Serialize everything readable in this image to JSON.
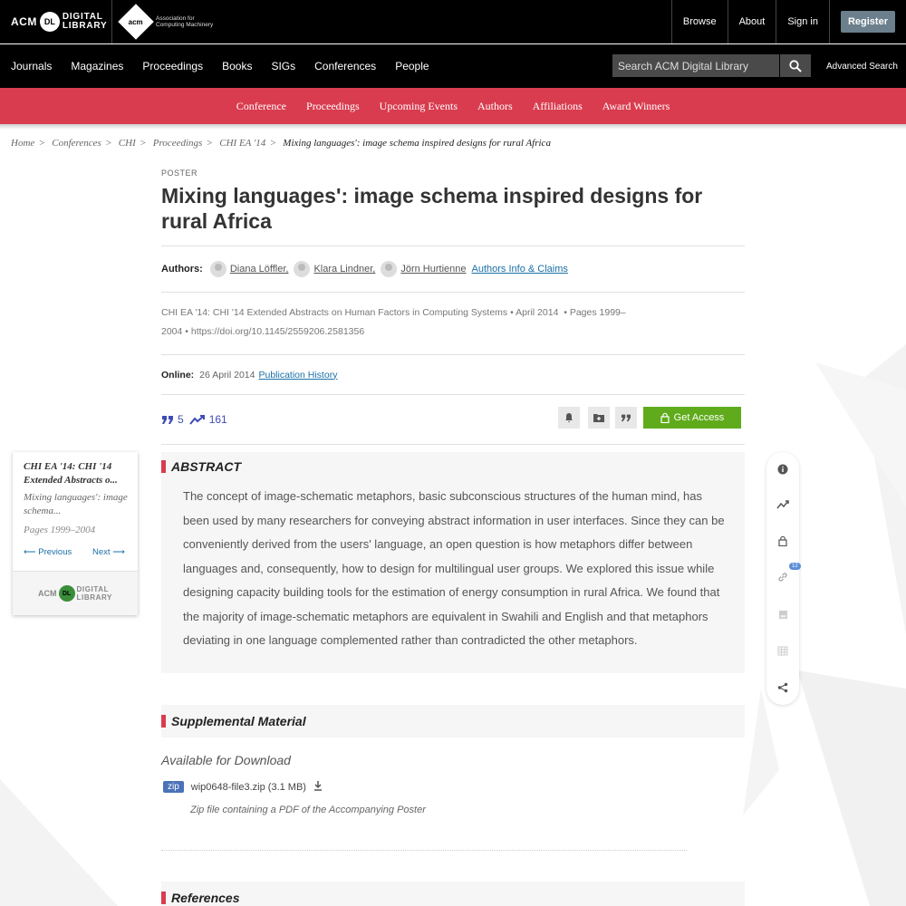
{
  "header": {
    "dl_logo": {
      "acm": "ACM",
      "badge": "DL",
      "line1": "DIGITAL",
      "line2": "LIBRARY"
    },
    "acm_logo": {
      "mark": "acm",
      "line1": "Association for",
      "line2": "Computing Machinery"
    },
    "links": [
      "Browse",
      "About",
      "Sign in"
    ],
    "register": "Register"
  },
  "nav": {
    "items": [
      "Journals",
      "Magazines",
      "Proceedings",
      "Books",
      "SIGs",
      "Conferences",
      "People"
    ],
    "search_placeholder": "Search ACM Digital Library",
    "advanced": "Advanced Search"
  },
  "subnav": [
    "Conference",
    "Proceedings",
    "Upcoming Events",
    "Authors",
    "Affiliations",
    "Award Winners"
  ],
  "breadcrumb": {
    "items": [
      "Home",
      "Conferences",
      "CHI",
      "Proceedings",
      "CHI EA '14"
    ],
    "current": "Mixing languages': image schema inspired designs for rural Africa"
  },
  "article": {
    "type": "POSTER",
    "title": "Mixing languages': image schema inspired designs for rural Africa",
    "authors_label": "Authors:",
    "authors": [
      "Diana Löffler,",
      "Klara Lindner,",
      "Jörn Hurtienne"
    ],
    "authors_info": "Authors Info & Claims",
    "venue_name": "CHI EA '14: CHI '14 Extended Abstracts on Human Factors in Computing Systems",
    "venue_date": "April 2014",
    "pages_line1": "Pages 1999–",
    "pages_line2": "2004",
    "doi": "https://doi.org/10.1145/2559206.2581356",
    "online_label": "Online:",
    "online_date": "26 April 2014",
    "pub_history": "Publication History",
    "citations": "5",
    "downloads": "161",
    "get_access": "Get Access"
  },
  "sidecard": {
    "title": "CHI EA '14: CHI '14 Extended Abstracts o...",
    "article": "Mixing languages': image schema...",
    "pages": "Pages 1999–2004",
    "previous": "Previous",
    "next": "Next",
    "logo": {
      "acm": "ACM",
      "badge": "DL",
      "line1": "DIGITAL",
      "line2": "LIBRARY"
    }
  },
  "abstract": {
    "heading": "ABSTRACT",
    "text": "The concept of image-schematic metaphors, basic subconscious structures of the human mind, has been used by many researchers for conveying abstract information in user interfaces. Since they can be conveniently derived from the users' language, an open question is how metaphors differ between languages and, consequently, how to design for multilingual user groups. We explored this issue while designing capacity building tools for the estimation of energy consumption in rural Africa. We found that the majority of image-schematic metaphors are equivalent in Swahili and English and that metaphors deviating in one language complemented rather than contradicted the other metaphors."
  },
  "toolbar": {
    "badge": "12",
    "icons": [
      "info-icon",
      "trend-icon",
      "lock-icon",
      "link-icon",
      "image-icon",
      "table-icon",
      "share-icon"
    ]
  },
  "supplemental": {
    "heading": "Supplemental Material",
    "available": "Available for Download",
    "file_type": "zip",
    "file_name": "wip0648-file3.zip (3.1 MB)",
    "file_desc": "Zip file containing a PDF of the Accompanying Poster"
  },
  "references": {
    "heading": "References"
  },
  "colors": {
    "accent_red": "#d93c4f",
    "access_green": "#5fab1b",
    "link_blue": "#1a6fa8",
    "metric_blue": "#3e4cb5"
  }
}
